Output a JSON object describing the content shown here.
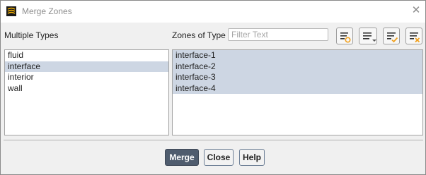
{
  "window": {
    "title": "Merge Zones",
    "icons": {
      "app": "ansys-fluent-icon",
      "close": "close-icon"
    }
  },
  "left_panel": {
    "label": "Multiple Types",
    "items": [
      "fluid",
      "interface",
      "interior",
      "wall"
    ],
    "selected": [
      "interface"
    ]
  },
  "right_panel": {
    "label": "Zones of Type",
    "filter": {
      "placeholder": "Filter Text",
      "value": ""
    },
    "toolbar": [
      "filter-options-icon",
      "select-options-icon",
      "select-all-icon",
      "deselect-all-icon"
    ],
    "items": [
      "interface-1",
      "interface-2",
      "interface-3",
      "interface-4"
    ],
    "selected": [
      "interface-1",
      "interface-2",
      "interface-3",
      "interface-4"
    ]
  },
  "buttons": {
    "merge": "Merge",
    "close": "Close",
    "help": "Help"
  },
  "colors": {
    "selection": "#cdd6e3",
    "primary_button": "#4f5c6e",
    "icon_orange": "#f0a01e",
    "icon_teal": "#1c8c8c"
  }
}
